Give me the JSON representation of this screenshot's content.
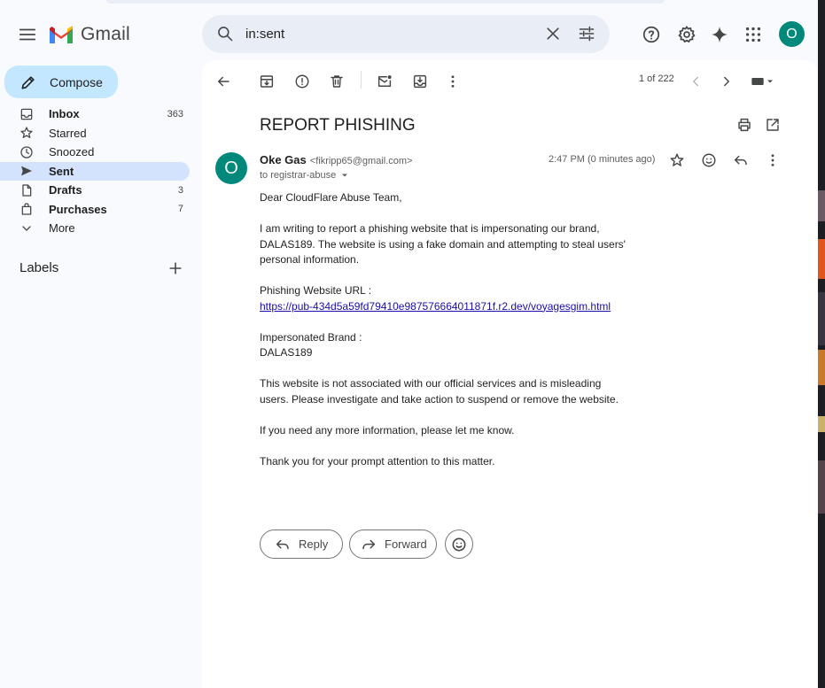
{
  "app": {
    "name": "Gmail"
  },
  "search": {
    "query": "in:sent"
  },
  "header": {
    "avatar_initial": "O",
    "icons": [
      "menu-icon",
      "search-icon",
      "close-icon",
      "tune-icon",
      "help-icon",
      "gear-icon",
      "sparkle-icon",
      "apps-icon"
    ]
  },
  "sidebar": {
    "compose_label": "Compose",
    "items": [
      {
        "label": "Inbox",
        "count": "363",
        "bold": true,
        "active": false,
        "icon": "inbox-icon"
      },
      {
        "label": "Starred",
        "count": "",
        "bold": false,
        "active": false,
        "icon": "star-icon"
      },
      {
        "label": "Snoozed",
        "count": "",
        "bold": false,
        "active": false,
        "icon": "clock-icon"
      },
      {
        "label": "Sent",
        "count": "",
        "bold": true,
        "active": true,
        "icon": "send-icon"
      },
      {
        "label": "Drafts",
        "count": "3",
        "bold": true,
        "active": false,
        "icon": "draft-icon"
      },
      {
        "label": "Purchases",
        "count": "7",
        "bold": true,
        "active": false,
        "icon": "bag-icon"
      },
      {
        "label": "More",
        "count": "",
        "bold": false,
        "active": false,
        "icon": "chevron-down-icon"
      }
    ],
    "labels_heading": "Labels"
  },
  "toolbar": {
    "pager": "1 of 222"
  },
  "email": {
    "subject": "REPORT PHISHING",
    "sender_name": "Oke Gas",
    "sender_email": "<fikripp65@gmail.com>",
    "recipient": "to registrar-abuse",
    "time": "2:47 PM (0 minutes ago)",
    "avatar_initial": "O",
    "body": {
      "greeting": "Dear CloudFlare Abuse Team,",
      "paragraph1": "I am writing to report a phishing website that is impersonating our brand, DALAS189. The website is using a fake domain and attempting to steal users' personal information.",
      "url_label": "Phishing Website URL :",
      "url": "https://pub-434d5a59fd79410e987576664011871f.r2.dev/voyagesgim.html",
      "brand_label": "Impersonated Brand :",
      "brand": "DALAS189",
      "paragraph2": "This website is not associated with our official services and is misleading users. Please investigate and take action to suspend or remove the website.",
      "paragraph3": "If you need any more information, please let me know.",
      "closing": "Thank you for your prompt attention to this matter."
    }
  },
  "actions": {
    "reply_label": "Reply",
    "forward_label": "Forward"
  },
  "colors": {
    "accent": "#c2e7ff",
    "active_nav": "#d3e3fd",
    "avatar": "#00897b",
    "link": "#1a0dab"
  }
}
